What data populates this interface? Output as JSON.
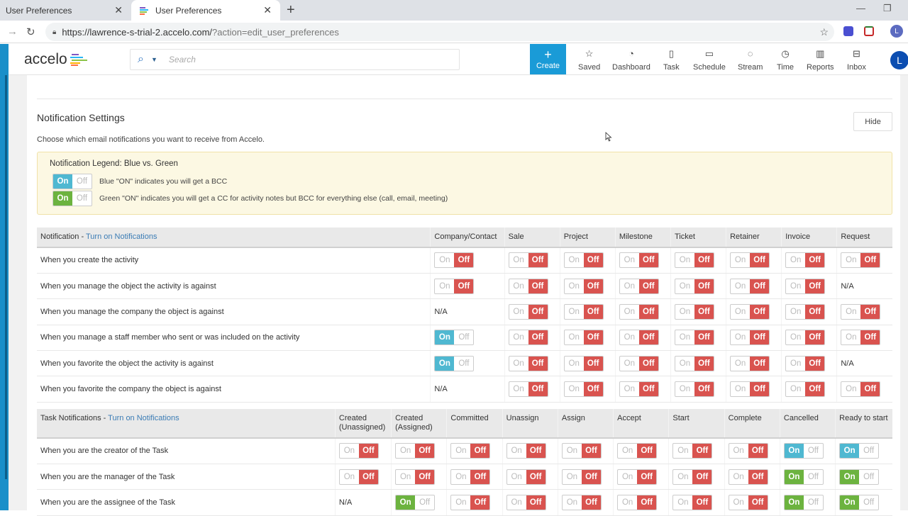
{
  "browser": {
    "tabs": [
      {
        "title": "User Preferences",
        "active": false
      },
      {
        "title": "User Preferences",
        "active": true
      }
    ],
    "url_main": "https://lawrence-s-trial-2.accelo.com/",
    "url_rest": "?action=edit_user_preferences",
    "profile_initial": "L"
  },
  "header": {
    "logo": "accelo",
    "search_placeholder": "Search",
    "create_label": "Create",
    "nav": [
      {
        "label": "Saved",
        "icon": "star-icon",
        "glyph": "☆"
      },
      {
        "label": "Dashboard",
        "icon": "gauge-icon",
        "glyph": "◔"
      },
      {
        "label": "Task",
        "icon": "clipboard-icon",
        "glyph": "▯"
      },
      {
        "label": "Schedule",
        "icon": "calendar-icon",
        "glyph": "▭"
      },
      {
        "label": "Stream",
        "icon": "chat-icon",
        "glyph": "◌"
      },
      {
        "label": "Time",
        "icon": "clock-icon",
        "glyph": "◷"
      },
      {
        "label": "Reports",
        "icon": "bar-chart-icon",
        "glyph": "▥"
      },
      {
        "label": "Inbox",
        "icon": "inbox-icon",
        "glyph": "⊟"
      }
    ],
    "avatar_initial": "L"
  },
  "notification_settings": {
    "title": "Notification Settings",
    "hide_label": "Hide",
    "subtitle": "Choose which email notifications you want to receive from Accelo.",
    "legend": {
      "title": "Notification Legend: Blue vs. Green",
      "on_label": "On",
      "off_label": "Off",
      "blue_text": "Blue \"ON\" indicates you will get a BCC",
      "green_text": "Green \"ON\" indicates you will get a CC for activity notes but BCC for everything else (call, email, meeting)"
    }
  },
  "activity_table": {
    "header_label": "Notification - ",
    "header_link": "Turn on Notifications",
    "columns": [
      "Company/Contact",
      "Sale",
      "Project",
      "Milestone",
      "Ticket",
      "Retainer",
      "Invoice",
      "Request"
    ],
    "rows": [
      {
        "label": "When you create the activity",
        "values": [
          "off",
          "off",
          "off",
          "off",
          "off",
          "off",
          "off",
          "off"
        ]
      },
      {
        "label": "When you manage the object the activity is against",
        "values": [
          "off",
          "off",
          "off",
          "off",
          "off",
          "off",
          "off",
          "na"
        ]
      },
      {
        "label": "When you manage the company the object is against",
        "values": [
          "na",
          "off",
          "off",
          "off",
          "off",
          "off",
          "off",
          "off"
        ]
      },
      {
        "label": "When you manage a staff member who sent or was included on the activity",
        "values": [
          "blue",
          "off",
          "off",
          "off",
          "off",
          "off",
          "off",
          "off"
        ]
      },
      {
        "label": "When you favorite the object the activity is against",
        "values": [
          "blue",
          "off",
          "off",
          "off",
          "off",
          "off",
          "off",
          "na"
        ]
      },
      {
        "label": "When you favorite the company the object is against",
        "values": [
          "na",
          "off",
          "off",
          "off",
          "off",
          "off",
          "off",
          "off"
        ]
      }
    ]
  },
  "task_table": {
    "header_label": "Task Notifications - ",
    "header_link": "Turn on Notifications",
    "columns": [
      "Created (Unassigned)",
      "Created (Assigned)",
      "Committed",
      "Unassign",
      "Assign",
      "Accept",
      "Start",
      "Complete",
      "Cancelled",
      "Ready to start"
    ],
    "rows": [
      {
        "label": "When you are the creator of the Task",
        "values": [
          "off",
          "off",
          "off",
          "off",
          "off",
          "off",
          "off",
          "off",
          "blue",
          "blue"
        ]
      },
      {
        "label": "When you are the manager of the Task",
        "values": [
          "off",
          "off",
          "off",
          "off",
          "off",
          "off",
          "off",
          "off",
          "green",
          "green"
        ]
      },
      {
        "label": "When you are the assignee of the Task",
        "values": [
          "na",
          "green",
          "off",
          "off",
          "off",
          "off",
          "off",
          "off",
          "green",
          "green"
        ]
      }
    ]
  },
  "labels": {
    "on": "On",
    "off": "Off",
    "na": "N/A"
  },
  "colors": {
    "accent": "#1a9bd7",
    "off_red": "#d9534f",
    "on_blue": "#4fb8d1",
    "on_green": "#6cb33f",
    "legend_bg": "#fcf8e3",
    "link": "#3b7cb5"
  }
}
